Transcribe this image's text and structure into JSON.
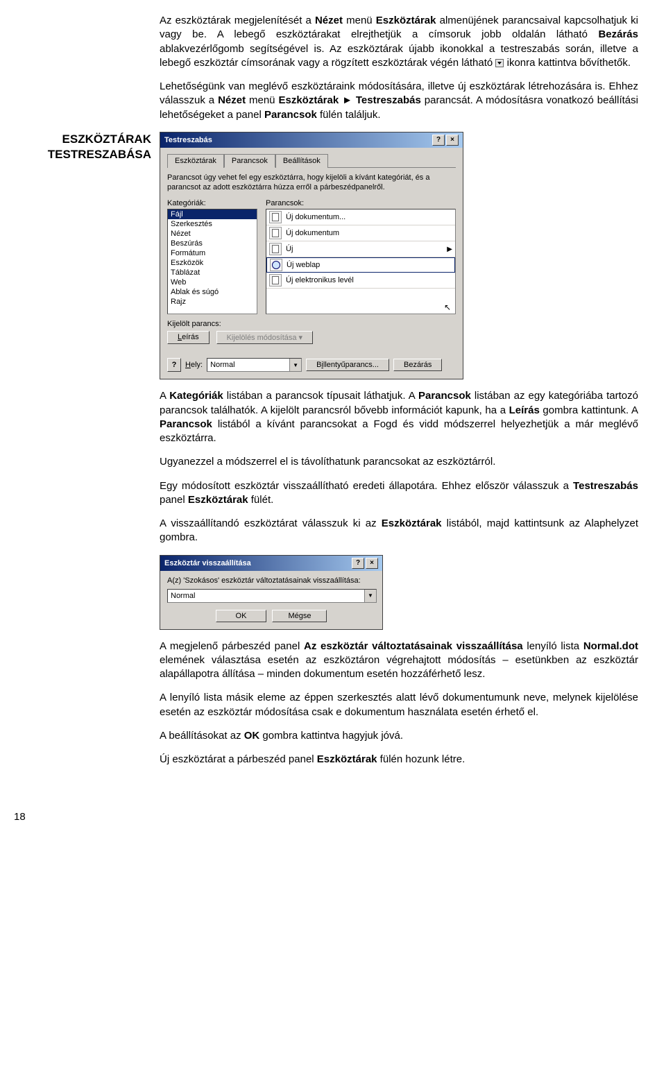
{
  "left_heading_l1": "ESZKÖZTÁRAK",
  "left_heading_l2": "TESTRESZABÁSA",
  "para1": "Az eszköztárak megjelenítését a ",
  "para1_b1": "Nézet",
  "para1_mid": " menü ",
  "para1_b2": "Eszköztárak",
  "para1_end": " almenüjének parancsaival kapcsolhatjuk ki vagy be. A lebegő eszköztárakat elrejthetjük a címsoruk jobb oldalán látható ",
  "para1_b3": "Bezárás",
  "para1_end2": " ablakvezérlőgomb segítségével is. Az eszköztárak újabb ikonokkal a testreszabás során, illetve a lebegő eszköztár címsorának vagy a rögzített eszköztárak végén látható ",
  "para1_end3": " ikonra kattintva bővíthetők.",
  "para2_a": "Lehetőségünk van meglévő eszköztáraink módosítására, illetve új eszköztárak létrehozására is. Ehhez válasszuk a ",
  "para2_b1": "Nézet",
  "para2_mid": " menü ",
  "para2_b2": "Eszköztárak ► Testreszabás",
  "para2_b": " parancsát. A módosításra vonatkozó beállítási lehetőségeket a panel ",
  "para2_b3": "Parancsok",
  "para2_c": " fülén találjuk.",
  "dialog1": {
    "title": "Testreszabás",
    "tabs": [
      "Eszköztárak",
      "Parancsok",
      "Beállítások"
    ],
    "hint": "Parancsot úgy vehet fel egy eszköztárra, hogy kijelöli a kívánt kategóriát, és a parancsot az adott eszköztárra húzza erről a párbeszédpanelről.",
    "lbl_cat": "Kategóriák:",
    "lbl_cmd": "Parancsok:",
    "categories": [
      "Fájl",
      "Szerkesztés",
      "Nézet",
      "Beszúrás",
      "Formátum",
      "Eszközök",
      "Táblázat",
      "Web",
      "Ablak és súgó",
      "Rajz"
    ],
    "commands": [
      "Új dokumentum...",
      "Új dokumentum",
      "Új",
      "Új weblap",
      "Új elektronikus levél"
    ],
    "selected_cmd_label": "Kijelölt parancs:",
    "btn_desc": "Leírás",
    "btn_modsel": "Kijelölés módosítása",
    "foot_help": "?",
    "foot_save_lbl": "Hely:",
    "foot_save_val": "Normal",
    "foot_key": "Billentyűparancs...",
    "foot_close": "Bezárás"
  },
  "para3_a": "A ",
  "para3_b1": "Kategóriák",
  "para3_mid1": " listában a parancsok típusait láthatjuk. A ",
  "para3_b2": "Parancsok",
  "para3_mid2": " listában az egy kategóriába tartozó parancsok találhatók. A kijelölt parancsról bővebb információt kapunk, ha a ",
  "para3_b3": "Leírás",
  "para3_mid3": " gombra kattintunk. A ",
  "para3_b4": "Parancsok",
  "para3_end": " listából a kívánt parancsokat a Fogd és vidd módszerrel helyezhetjük a már meglévő eszköztárra.",
  "para4": "Ugyanezzel a módszerrel el is távolíthatunk parancsokat az eszköztárról.",
  "para5_a": "Egy módosított eszköztár visszaállítható eredeti állapotára. Ehhez először válasszuk a ",
  "para5_b1": "Testreszabás",
  "para5_mid": " panel ",
  "para5_b2": "Eszköztárak",
  "para5_end": " fülét.",
  "para6_a": "A visszaállítandó eszköztárat válasszuk ki az ",
  "para6_b1": "Eszköztárak",
  "para6_end": " listából, majd kattintsunk az Alaphelyzet gombra.",
  "dialog2": {
    "title": "Eszköztár visszaállítása",
    "msg": "A(z) 'Szokásos' eszköztár változtatásainak visszaállítása:",
    "val": "Normal",
    "ok": "OK",
    "cancel": "Mégse"
  },
  "para7_a": "A megjelenő párbeszéd panel ",
  "para7_b1": "Az eszköztár változtatásainak visszaállítása",
  "para7_mid": " lenyíló lista ",
  "para7_b2": "Normal.dot",
  "para7_end": " elemének választása esetén az eszköztáron végrehajtott módosítás – esetünkben az eszköztár alapállapotra állítása – minden dokumentum esetén hozzáférhető lesz.",
  "para8": "A lenyíló lista másik eleme az éppen szerkesztés alatt lévő dokumentumunk neve, melynek kijelölése esetén az eszköztár módosítása csak e dokumentum használata esetén érhető el.",
  "para9_a": "A beállításokat az ",
  "para9_b1": "OK",
  "para9_end": " gombra kattintva hagyjuk jóvá.",
  "para10_a": "Új eszköztárat a párbeszéd panel ",
  "para10_b1": "Eszköztárak",
  "para10_end": " fülén hozunk létre.",
  "page_number": "18"
}
